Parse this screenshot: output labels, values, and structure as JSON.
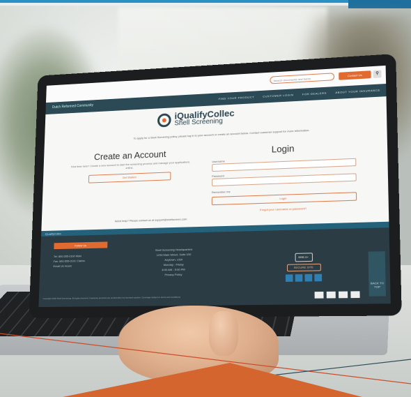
{
  "site": {
    "search_placeholder": "Search documents and forms",
    "orange_button": "Contact Us",
    "search_button_icon": "magnifier-icon",
    "brand": "Dutch Reformed Community",
    "nav": [
      "FIND YOUR PRODUCT",
      "CUSTOMER LOGIN",
      "FOR DEALERS",
      "ABOUT YOUR INSURANCE"
    ],
    "logo_line1": "iQualifyCollec",
    "logo_line2": "Shell Screening",
    "intro": "To apply for a Shell Screening policy, please log in to your account or create an account below. Contact customer support for more information.",
    "create": {
      "title": "Create an Account",
      "text": "First time here? Create a new account to start the screening process and manage your applications online.",
      "button": "Get Started"
    },
    "login": {
      "title": "Login",
      "username_label": "Username",
      "password_label": "Password",
      "remember_label": "Remember me",
      "button": "Login",
      "forgot": "Forgot your username or password?"
    },
    "help_line": "Need help? Please contact us at support@shellscreen.com",
    "footer": {
      "strip": "iQualifyCollec",
      "follow": "Follow Us",
      "rows": [
        "Tel: 800-555-0100  Main",
        "Fax: 800-555-0101  Claims",
        "Email Us  Hours"
      ],
      "mid": [
        "Shell Screening Headquarters",
        "1234 Main Street, Suite 100",
        "Anytown, USA",
        "Monday - Friday",
        "8:00 AM - 5:00 PM",
        "Privacy Policy"
      ],
      "badge": "BBB A+",
      "wide_badge": "SECURE SITE",
      "legal": "Copyright 2020 Shell Screening. All rights reserved. Insurance products are underwritten by licensed carriers. Coverage subject to terms and conditions.",
      "back_to_top": "BACK TO TOP"
    }
  },
  "colors": {
    "accent_orange": "#e06a2f",
    "nav_teal": "#2b4a56",
    "footer_dark": "#2b3c44",
    "top_blue": "#2b90c4"
  }
}
